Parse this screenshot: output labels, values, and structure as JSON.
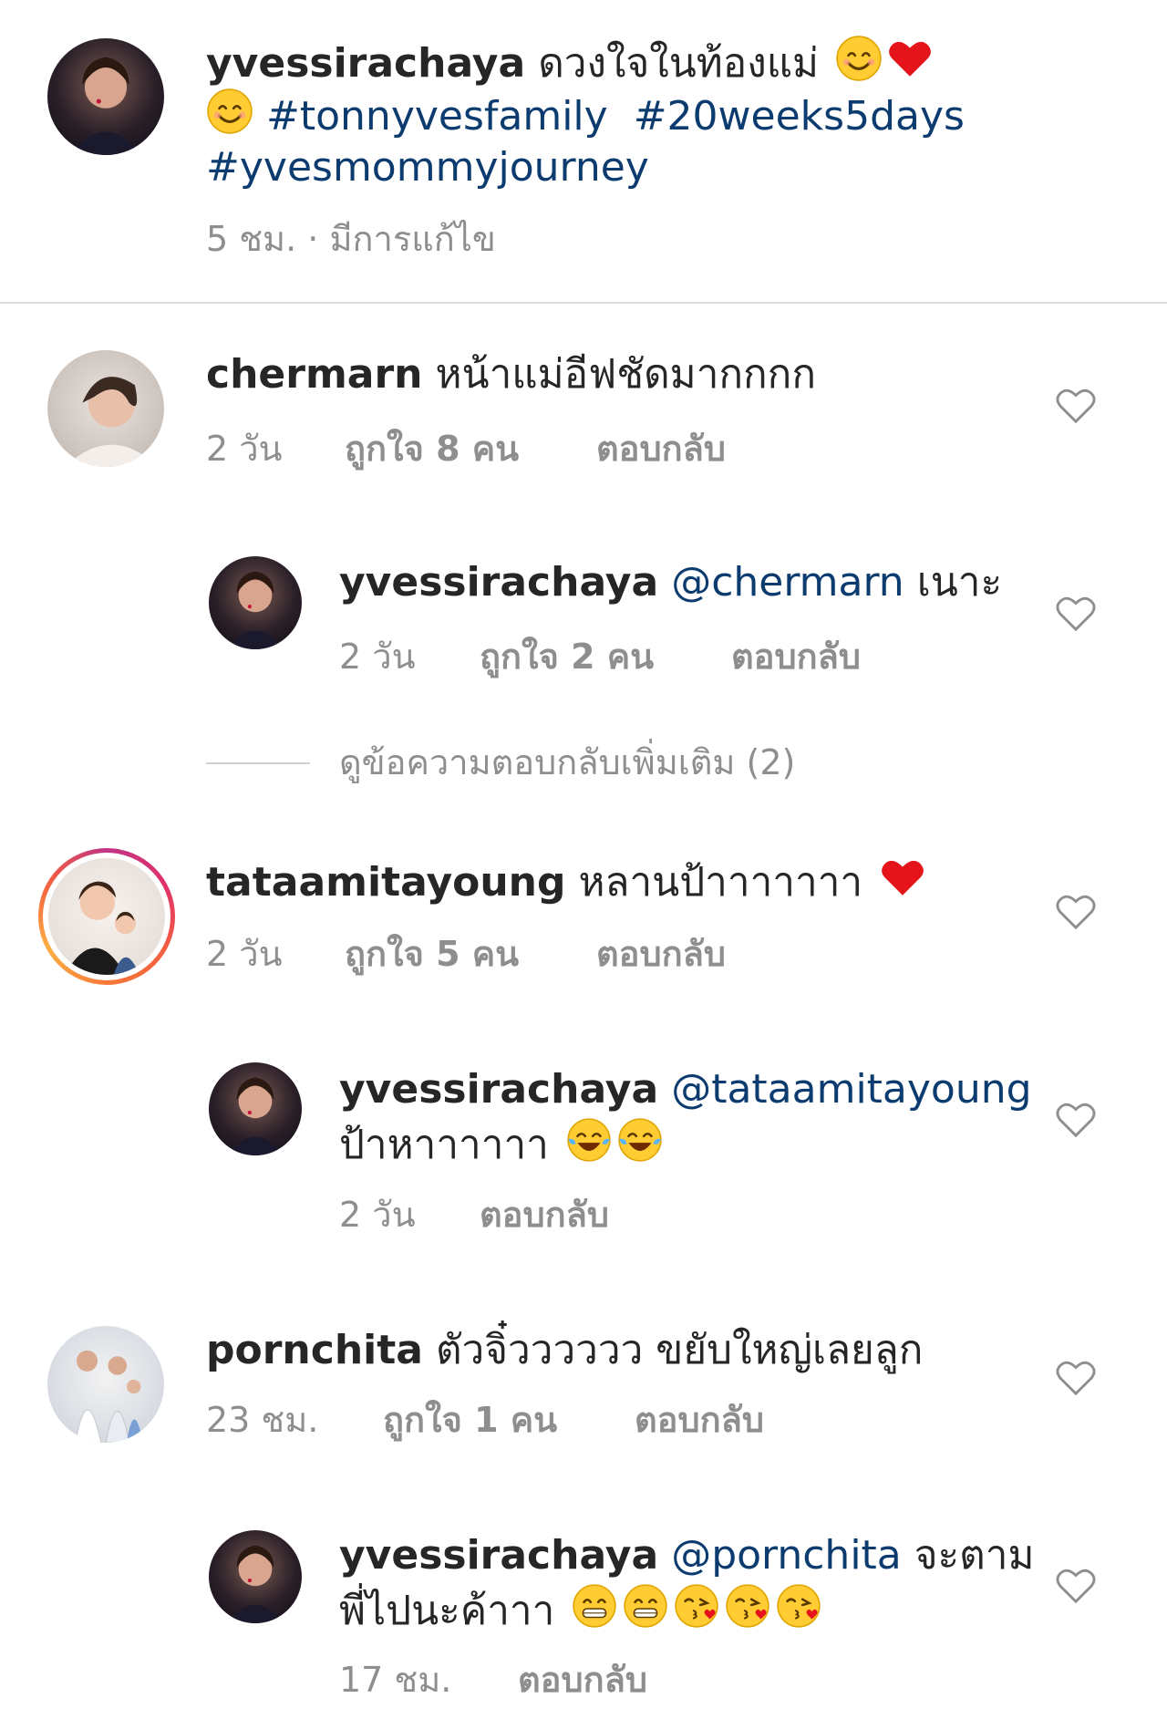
{
  "post": {
    "username": "yvessirachaya",
    "caption": "ดวงใจในท้องแม่",
    "hashtags": [
      "#tonnyvesfamily",
      "#20weeks5days",
      "#yvesmommyjourney"
    ],
    "time": "5 ชม.",
    "edited": "· มีการแก้ไข",
    "caption_emojis": [
      "smiling-face-icon",
      "red-heart-icon",
      "smiling-face-icon"
    ]
  },
  "comments": [
    {
      "username": "chermarn",
      "text": "หน้าแม่อีฟชัดมากกกก",
      "time": "2 วัน",
      "likes": "ถูกใจ 8 คน",
      "reply": "ตอบกลับ"
    },
    {
      "username": "yvessirachaya",
      "mention": "@chermarn",
      "text": "เนาะ",
      "time": "2 วัน",
      "likes": "ถูกใจ 2 คน",
      "reply": "ตอบกลับ"
    },
    {
      "view_more": "ดูข้อความตอบกลับเพิ่มเติม (2)"
    },
    {
      "username": "tataamitayoung",
      "text": "หลานป้าาาาาาา",
      "time": "2 วัน",
      "likes": "ถูกใจ 5 คน",
      "reply": "ตอบกลับ",
      "emojis": [
        "red-heart-icon"
      ]
    },
    {
      "username": "yvessirachaya",
      "mention": "@tataamitayoung",
      "text": "ป้าหาาาาาา",
      "time": "2 วัน",
      "reply": "ตอบกลับ",
      "emojis": [
        "tears-of-joy-icon",
        "tears-of-joy-icon"
      ]
    },
    {
      "username": "pornchita",
      "text": "ตัวจิ๋วววววว ขยับใหญ่เลยลูก",
      "time": "23 ชม.",
      "likes": "ถูกใจ 1 คน",
      "reply": "ตอบกลับ"
    },
    {
      "username": "yvessirachaya",
      "mention": "@pornchita",
      "text": "จะตาม",
      "text2": "พี่ไปนะค้าาา",
      "time": "17 ชม.",
      "reply": "ตอบกลับ",
      "emojis": [
        "grinning-face-icon",
        "grinning-face-icon",
        "kissing-heart-icon",
        "kissing-heart-icon",
        "kissing-heart-icon"
      ]
    }
  ],
  "colors": {
    "text": "#262626",
    "hashtag": "#0b3b6f",
    "meta": "#8e8e8e",
    "divider": "#dbdbdb"
  }
}
